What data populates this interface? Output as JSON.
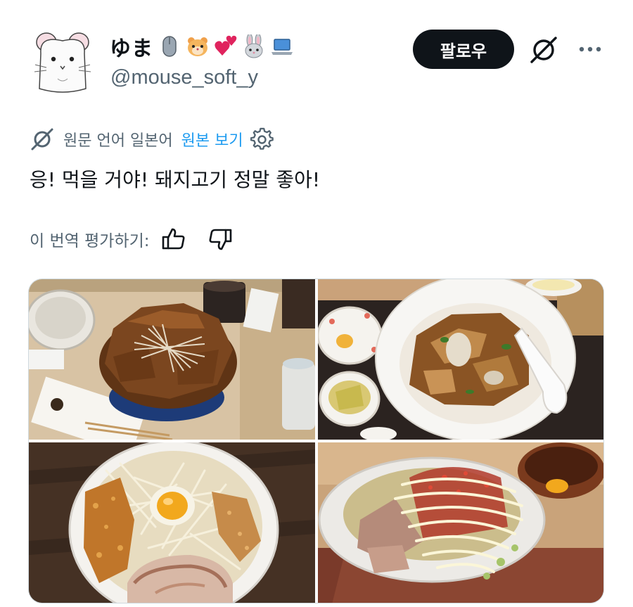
{
  "author": {
    "display_name": "ゆま",
    "name_emojis": [
      "computer-mouse-icon",
      "hamster-face-icon",
      "two-hearts-icon",
      "rabbit-face-icon",
      "laptop-icon"
    ],
    "handle": "@mouse_soft_y",
    "follow_label": "팔로우"
  },
  "translation": {
    "notice": "원문 언어 일본어",
    "show_original": "원본 보기"
  },
  "tweet": {
    "text": "응! 먹을 거야! 돼지고기 정말 좋아!"
  },
  "rating": {
    "label": "이 번역 평가하기:"
  },
  "media": {
    "photos": [
      {
        "depicts": "pork-belly-rice-bowl-photo"
      },
      {
        "depicts": "stir-fried-pork-rice-plate-photo"
      },
      {
        "depicts": "ramen-with-egg-yolk-photo"
      },
      {
        "depicts": "ramen-with-mayonnaise-photo"
      }
    ]
  },
  "colors": {
    "text_primary": "#0f1419",
    "text_secondary": "#536471",
    "link": "#1d9bf0",
    "follow_bg": "#0f1419",
    "border": "#cfd9de"
  }
}
